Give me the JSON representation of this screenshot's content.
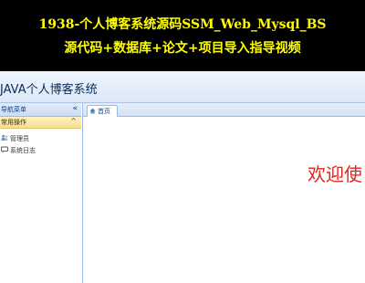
{
  "banner": {
    "line1": "1938-个人博客系统源码SSM_Web_Mysql_BS",
    "line2": "源代码+数据库+论文+项目导入指导视频"
  },
  "header": {
    "title": "JAVA个人博客系统"
  },
  "sidebar": {
    "title": "导航菜单",
    "collapse_icon": "«",
    "group": {
      "label": "常用操作",
      "arrow": "^"
    },
    "items": [
      {
        "label": "管理员",
        "icon": "users-icon"
      },
      {
        "label": "系统日志",
        "icon": "chat-icon"
      }
    ]
  },
  "tabs": [
    {
      "label": "首页",
      "icon": "home-icon"
    }
  ],
  "content": {
    "welcome": "欢迎使"
  },
  "colors": {
    "banner_bg": "#000000",
    "banner_text": "#ffff00",
    "welcome_text": "#e3231c",
    "accent_blue": "#99bbe8"
  }
}
